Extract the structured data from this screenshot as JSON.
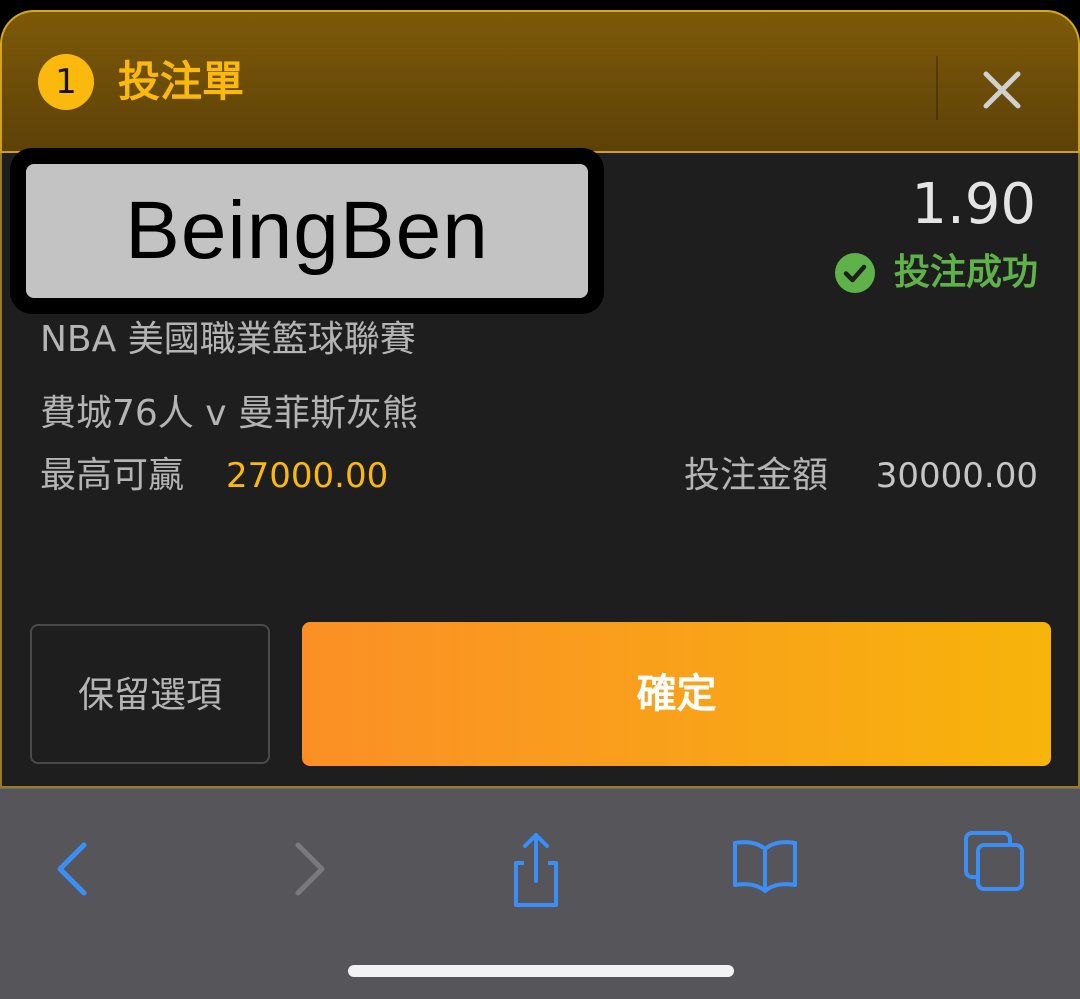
{
  "header": {
    "count": "1",
    "title": "投注單"
  },
  "watermark": {
    "text": "BeingBen"
  },
  "bet": {
    "odds": "1.90",
    "status": "投注成功",
    "league": "NBA 美國職業籃球聯賽",
    "match": "費城76人 v 曼菲斯灰熊",
    "max_win_label": "最高可贏",
    "max_win_value": "27000.00",
    "stake_label": "投注金額",
    "stake_value": "30000.00"
  },
  "actions": {
    "keep_label": "保留選項",
    "confirm_label": "確定"
  },
  "colors": {
    "accent": "#fbb80d",
    "success": "#5fb24a",
    "toolbar_icon": "#3a8ef6"
  },
  "toolbar": {
    "icons": [
      "back-icon",
      "forward-icon",
      "share-icon",
      "bookmarks-icon",
      "tabs-icon"
    ]
  }
}
